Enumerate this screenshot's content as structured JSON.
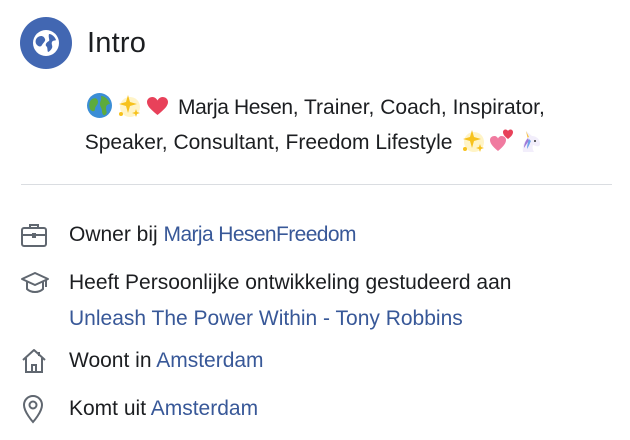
{
  "intro": {
    "title": "Intro",
    "icon": "globe-icon",
    "badge_color": "#4267b2"
  },
  "bio": {
    "name": "Marja Hesen",
    "line1_rest": ", Trainer, Coach, Inspirator,",
    "line2": "Speaker, Consultant, Freedom Lifestyle",
    "leading_emojis": [
      "earth-globe-icon",
      "sparkles-icon",
      "heart-icon"
    ],
    "trailing_emojis": [
      "sparkles-icon",
      "two-hearts-icon",
      "unicorn-icon"
    ]
  },
  "details": [
    {
      "icon": "briefcase-icon",
      "prefix": "Owner bij",
      "link1": "Marja Hesen",
      "link2": "Freedom"
    },
    {
      "icon": "graduation-cap-icon",
      "prefix": "Heeft Persoonlijke ontwikkeling gestudeerd aan",
      "link": "Unleash The Power Within - Tony Robbins"
    },
    {
      "icon": "home-icon",
      "prefix": "Woont in",
      "link": "Amsterdam"
    },
    {
      "icon": "location-pin-icon",
      "prefix": "Komt uit",
      "link": "Amsterdam"
    }
  ],
  "colors": {
    "link": "#385898",
    "text": "#1c1e21",
    "divider": "#dadde1",
    "icon": "#606770"
  }
}
